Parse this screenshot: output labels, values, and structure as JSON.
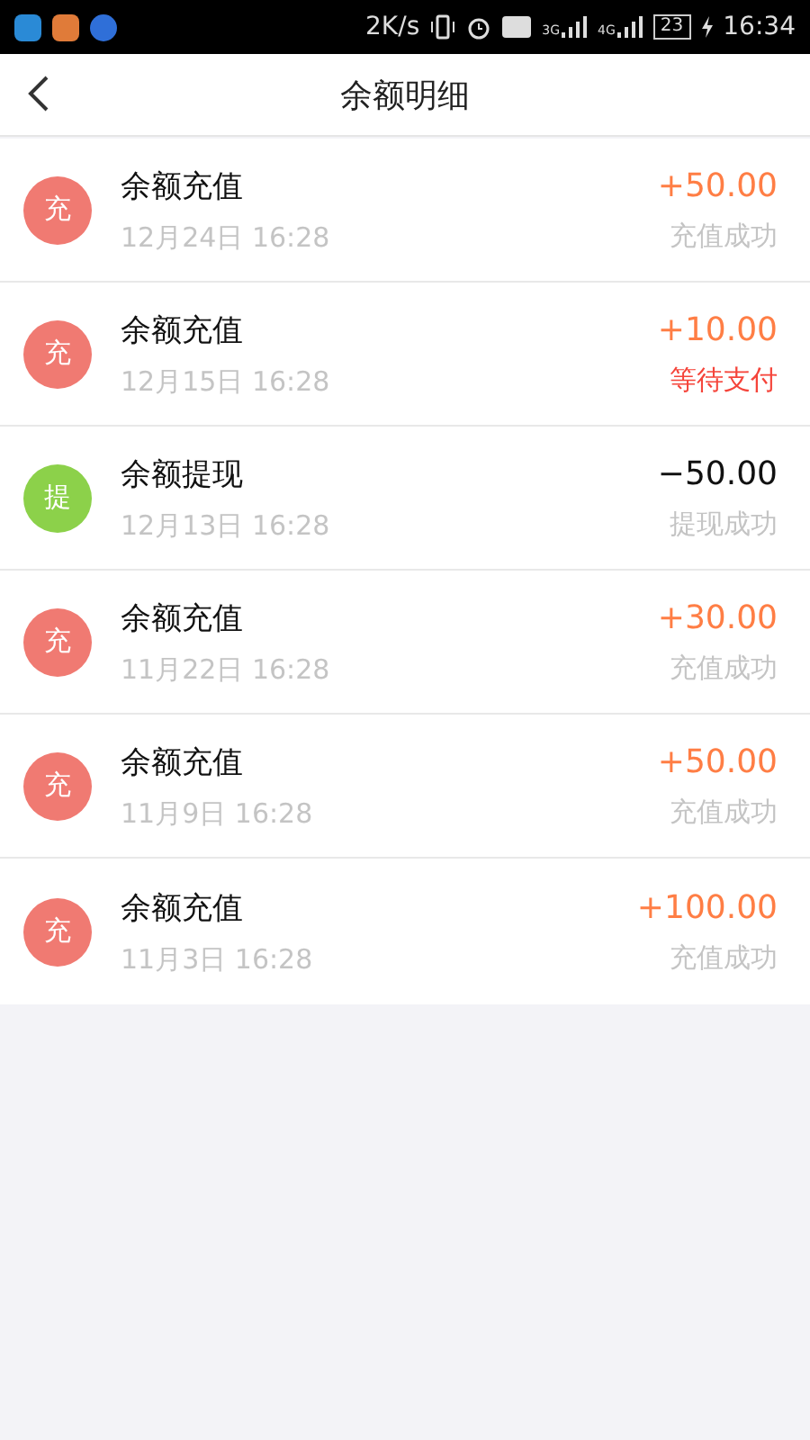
{
  "status_bar": {
    "speed": "2K/s",
    "network_1": "3G",
    "network_2": "4G",
    "battery": "23",
    "time": "16:34"
  },
  "header": {
    "title": "余额明细"
  },
  "records": [
    {
      "kind": "recharge",
      "badge": "充",
      "title": "余额充值",
      "time": "12月24日 16:28",
      "amount": "+50.00",
      "status": "充值成功",
      "pending": false
    },
    {
      "kind": "recharge",
      "badge": "充",
      "title": "余额充值",
      "time": "12月15日 16:28",
      "amount": "+10.00",
      "status": "等待支付",
      "pending": true
    },
    {
      "kind": "withdraw",
      "badge": "提",
      "title": "余额提现",
      "time": "12月13日 16:28",
      "amount": "−50.00",
      "status": "提现成功",
      "pending": false
    },
    {
      "kind": "recharge",
      "badge": "充",
      "title": "余额充值",
      "time": "11月22日 16:28",
      "amount": "+30.00",
      "status": "充值成功",
      "pending": false
    },
    {
      "kind": "recharge",
      "badge": "充",
      "title": "余额充值",
      "time": "11月9日 16:28",
      "amount": "+50.00",
      "status": "充值成功",
      "pending": false
    },
    {
      "kind": "recharge",
      "badge": "充",
      "title": "余额充值",
      "time": "11月3日 16:28",
      "amount": "+100.00",
      "status": "充值成功",
      "pending": false
    }
  ]
}
